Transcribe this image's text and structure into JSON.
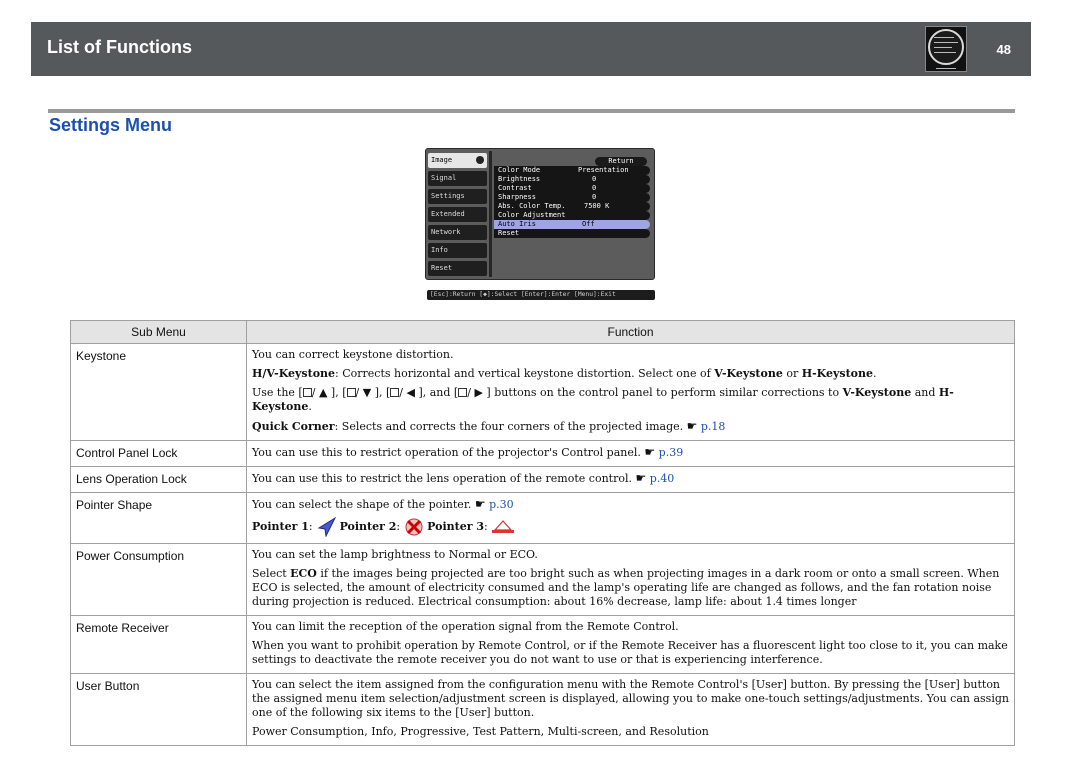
{
  "header": {
    "title": "List of Functions",
    "page_number": "48"
  },
  "section": {
    "title": "Settings  Menu"
  },
  "osd": {
    "tabs": [
      "Image",
      "Signal",
      "Settings",
      "Extended",
      "Network",
      "Info",
      "Reset"
    ],
    "return_label": "Return",
    "rows": [
      {
        "label": "Color Mode",
        "value": "Presentation"
      },
      {
        "label": "Brightness",
        "value": "0"
      },
      {
        "label": "Contrast",
        "value": "0"
      },
      {
        "label": "Sharpness",
        "value": "0"
      },
      {
        "label": "Abs. Color Temp.",
        "value": "7500  K"
      },
      {
        "label": "Color Adjustment",
        "value": ""
      },
      {
        "label": "Auto Iris",
        "value": "Off"
      },
      {
        "label": "Reset",
        "value": ""
      }
    ],
    "help_bar": "[Esc]:Return [◆]:Select [Enter]:Enter    [Menu]:Exit"
  },
  "table": {
    "col1_header": "Sub Menu",
    "col2_header": "Function",
    "keystone": {
      "name": "Keystone",
      "p1": "You can correct keystone distortion.",
      "hv_label": "H/V-Keystone",
      "hv_text": ": Corrects horizontal and vertical keystone distortion. Select one of ",
      "v_keystone": "V-Keystone",
      "or": " or ",
      "h_keystone": "H-Keystone",
      "period": ".",
      "use_the": "Use the [",
      "sep1": "/",
      "c1": "], [",
      "c2": "], [",
      "and": "], and [",
      "buttons_text": "] buttons on the control panel to perform similar corrections to ",
      "and2": " and ",
      "qc_label": "Quick Corner",
      "qc_text": ": Selects and corrects the four corners of the projected image. ",
      "qc_link": "p.18"
    },
    "control_panel_lock": {
      "name": "Control Panel Lock",
      "text": "You can use this to restrict operation of the projector's Control panel. ",
      "link": "p.39"
    },
    "lens_operation_lock": {
      "name": "Lens Operation Lock",
      "text": "You can use this to restrict the lens operation of the remote control. ",
      "link": "p.40"
    },
    "pointer_shape": {
      "name": "Pointer Shape",
      "text": "You can select the shape of the pointer. ",
      "link": "p.30",
      "pointer1": "Pointer 1",
      "pointer2": "Pointer 2",
      "pointer3": "Pointer 3",
      "colon": ": "
    },
    "power_consumption": {
      "name": "Power Consumption",
      "p1": "You can set the lamp brightness to Normal or ECO.",
      "p2a": "Select ",
      "p2b": "ECO",
      "p2c": " if the images being projected are too bright such as when projecting images in a dark room or onto a small screen. When ECO is selected, the amount of electricity consumed and the lamp's operating life are changed as follows, and the fan rotation noise during projection is reduced. Electrical consumption: about 16% decrease, lamp life: about 1.4 times longer"
    },
    "remote_receiver": {
      "name": "Remote Receiver",
      "p1": "You can limit the reception of the operation signal from the Remote Control.",
      "p2": "When you want to prohibit operation by Remote Control, or if the Remote Receiver has a fluorescent light too close to it, you can make settings to deactivate the remote receiver you do not want to use or that is experiencing interference."
    },
    "user_button": {
      "name": "User Button",
      "p1": "You can select the item assigned from the configuration menu with the Remote Control's [User] button. By pressing the [User] button the assigned menu item selection/adjustment screen is displayed, allowing you to make one-touch settings/adjustments. You can assign one of the following six items to the [User] button.",
      "p2": "Power Consumption, Info, Progressive, Test Pattern, Multi-screen, and Resolution"
    }
  },
  "colors": {
    "header_bg": "#56595c",
    "section_title": "#1d4fb3",
    "link": "#1d4fb3",
    "osd_highlight": "#9ea5e0"
  }
}
